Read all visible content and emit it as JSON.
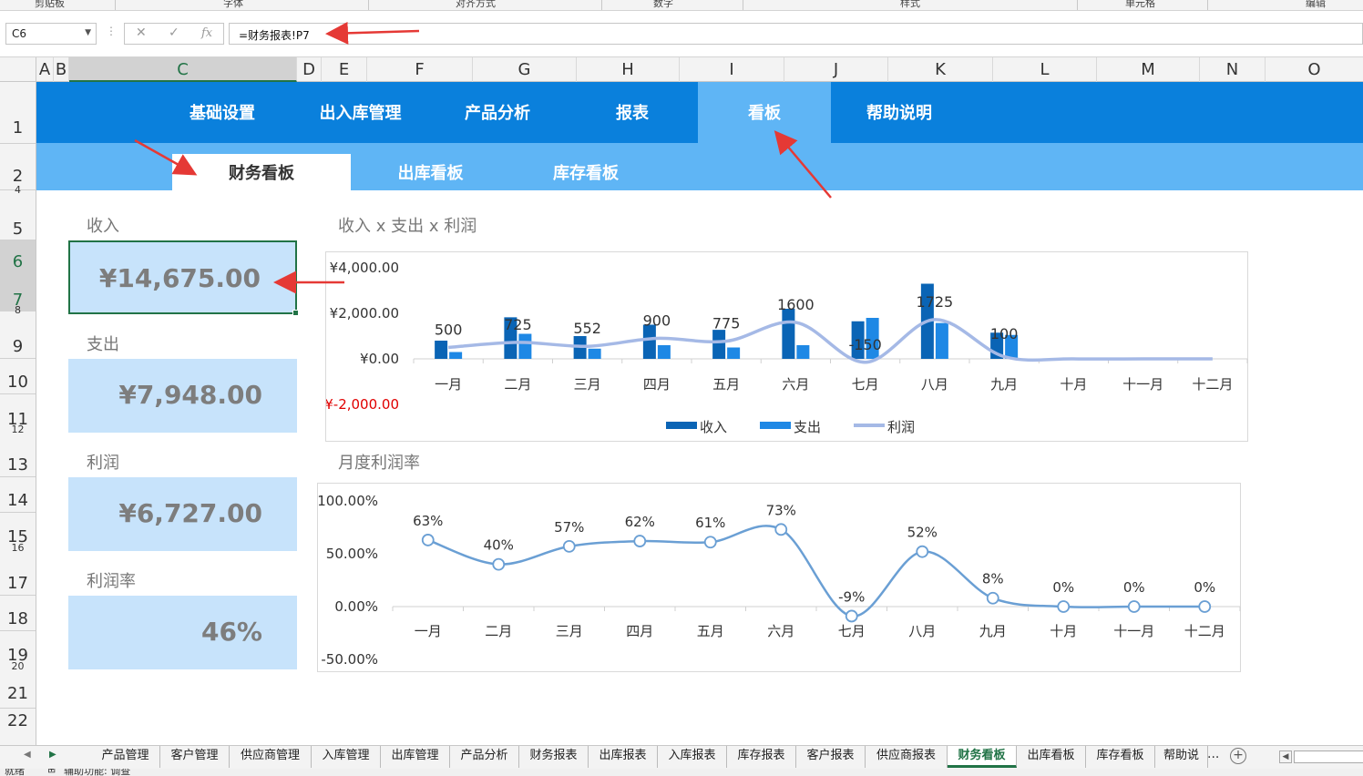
{
  "ribbon": {
    "groups": [
      "剪贴板",
      "字体",
      "对齐方式",
      "数字",
      "样式",
      "单元格",
      "编辑"
    ]
  },
  "formula_bar": {
    "cell_ref": "C6",
    "formula": "=财务报表!P7",
    "fx_label": "fx",
    "cancel_icon": "✕",
    "enter_icon": "✓"
  },
  "columns": [
    "A",
    "B",
    "C",
    "D",
    "E",
    "F",
    "G",
    "H",
    "I",
    "J",
    "K",
    "L",
    "M",
    "N",
    "O"
  ],
  "rows": [
    "1",
    "2",
    "4",
    "5",
    "6",
    "7",
    "8",
    "9",
    "10",
    "11",
    "12",
    "13",
    "14",
    "15",
    "16",
    "17",
    "18",
    "19",
    "20",
    "21",
    "22"
  ],
  "nav": {
    "items": [
      "基础设置",
      "出入库管理",
      "产品分析",
      "报表",
      "看板",
      "帮助说明"
    ],
    "active": "看板"
  },
  "subnav": {
    "items": [
      "财务看板",
      "出库看板",
      "库存看板"
    ],
    "active": "财务看板"
  },
  "kpis": [
    {
      "label": "收入",
      "value": "¥14,675.00"
    },
    {
      "label": "支出",
      "value": "¥7,948.00"
    },
    {
      "label": "利润",
      "value": "¥6,727.00"
    },
    {
      "label": "利润率",
      "value": "46%"
    }
  ],
  "colors": {
    "nav_bg": "#0a80dc",
    "nav_active": "#5fb5f5",
    "kpi_bg": "#c7e3fb",
    "income": "#0a64b5",
    "expense": "#1e88e5",
    "profit": "#a5b9e6",
    "margin": "#6a9fd4",
    "negative_tick": "#e00000",
    "annotation_arrow": "#e53935",
    "excel_green": "#217346"
  },
  "chart_data": [
    {
      "type": "bar",
      "title": "收入 x 支出 x 利润",
      "categories": [
        "一月",
        "二月",
        "三月",
        "四月",
        "五月",
        "六月",
        "七月",
        "八月",
        "九月",
        "十月",
        "十一月",
        "十二月"
      ],
      "yticks": [
        "¥4,000.00",
        "¥2,000.00",
        "¥0.00",
        "¥-2,000.00"
      ],
      "ylim": [
        -2000,
        4000
      ],
      "legend_position": "bottom",
      "series": [
        {
          "name": "收入",
          "type": "bar",
          "values": [
            800,
            1825,
            1000,
            1500,
            1275,
            2200,
            1650,
            3300,
            1150,
            0,
            0,
            0
          ]
        },
        {
          "name": "支出",
          "type": "bar",
          "values": [
            300,
            1100,
            448,
            600,
            500,
            600,
            1800,
            1575,
            1050,
            0,
            0,
            0
          ]
        },
        {
          "name": "利润",
          "type": "line",
          "values": [
            500,
            725,
            552,
            900,
            775,
            1600,
            -150,
            1725,
            100,
            0,
            0,
            0
          ]
        }
      ],
      "data_labels": [
        "500",
        "725",
        "552",
        "900",
        "775",
        "1600",
        "-150",
        "1725",
        "100",
        "",
        "",
        ""
      ]
    },
    {
      "type": "line",
      "title": "月度利润率",
      "categories": [
        "一月",
        "二月",
        "三月",
        "四月",
        "五月",
        "六月",
        "七月",
        "八月",
        "九月",
        "十月",
        "十一月",
        "十二月"
      ],
      "yticks": [
        "100.00%",
        "50.00%",
        "0.00%",
        "-50.00%"
      ],
      "ylim": [
        -0.5,
        1.0
      ],
      "series": [
        {
          "name": "利润率",
          "values": [
            0.63,
            0.4,
            0.57,
            0.62,
            0.61,
            0.73,
            -0.09,
            0.52,
            0.08,
            0,
            0,
            0
          ]
        }
      ],
      "data_labels": [
        "63%",
        "40%",
        "57%",
        "62%",
        "61%",
        "73%",
        "-9%",
        "52%",
        "8%",
        "0%",
        "0%",
        "0%"
      ]
    }
  ],
  "sheet_tabs": {
    "items": [
      "产品管理",
      "客户管理",
      "供应商管理",
      "入库管理",
      "出库管理",
      "产品分析",
      "财务报表",
      "出库报表",
      "入库报表",
      "库存报表",
      "客户报表",
      "供应商报表",
      "财务看板",
      "出库看板",
      "库存看板",
      "帮助说"
    ],
    "active": "财务看板",
    "more": "..."
  },
  "status": {
    "ready": "就绪",
    "accessibility": "辅助功能: 调查"
  }
}
